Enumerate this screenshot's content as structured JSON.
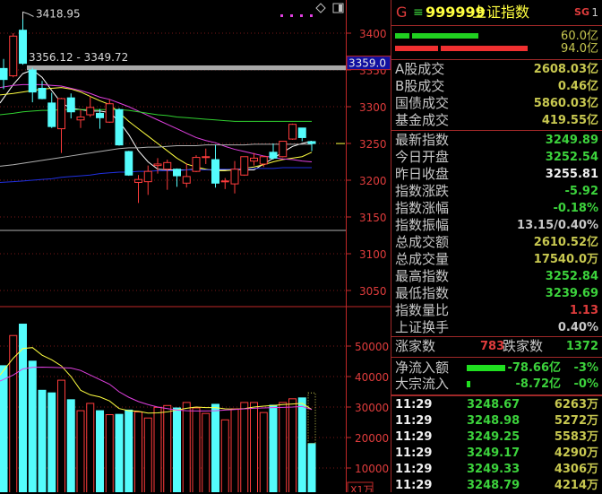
{
  "chart_data": {
    "type": "candlestick",
    "price_axis": {
      "ticks": [
        3400,
        3350,
        3300,
        3250,
        3200,
        3150,
        3100,
        3050
      ]
    },
    "volume_axis": {
      "ticks": [
        50000,
        40000,
        30000,
        20000,
        10000
      ],
      "unit_label": "X1万"
    },
    "high_label": "3418.95",
    "band_label": "3356.12 - 3349.72",
    "band": [
      3349.72,
      3356.12
    ],
    "cursor_price_label": "3359.0",
    "cursor_price": 3359.0,
    "current_price": 3249.89,
    "candles": [
      [
        3352,
        3365,
        3324,
        3337
      ],
      [
        3342,
        3400,
        3340,
        3396
      ],
      [
        3404,
        3418.95,
        3357,
        3359
      ],
      [
        3350,
        3353,
        3306,
        3320
      ],
      [
        3325,
        3335,
        3310,
        3311
      ],
      [
        3305,
        3319,
        3271,
        3273
      ],
      [
        3270,
        3312,
        3237,
        3311
      ],
      [
        3312,
        3318,
        3284,
        3293
      ],
      [
        3282,
        3296,
        3271,
        3286
      ],
      [
        3289,
        3314,
        3286,
        3299
      ],
      [
        3291,
        3297,
        3270,
        3285
      ],
      [
        3279,
        3310,
        3278,
        3304
      ],
      [
        3296,
        3298,
        3247,
        3248
      ],
      [
        3239,
        3240,
        3206,
        3207
      ],
      [
        3197,
        3207,
        3169,
        3201
      ],
      [
        3198,
        3220,
        3180,
        3212
      ],
      [
        3220,
        3230,
        3209,
        3222
      ],
      [
        3215,
        3228,
        3187,
        3224
      ],
      [
        3215,
        3216,
        3191,
        3206
      ],
      [
        3196,
        3223,
        3190,
        3205
      ],
      [
        3212,
        3234,
        3211,
        3231
      ],
      [
        3231,
        3243,
        3222,
        3232
      ],
      [
        3228,
        3248,
        3190,
        3196
      ],
      [
        3198,
        3203,
        3188,
        3199
      ],
      [
        3195,
        3226,
        3182,
        3215
      ],
      [
        3207,
        3232,
        3206,
        3232
      ],
      [
        3226,
        3237,
        3220,
        3230
      ],
      [
        3222,
        3233,
        3218,
        3232
      ],
      [
        3238,
        3250,
        3228,
        3230
      ],
      [
        3232,
        3253,
        3231,
        3253
      ],
      [
        3256,
        3277,
        3255,
        3276
      ],
      [
        3271,
        3271,
        3253,
        3258
      ],
      [
        3252.54,
        3252.84,
        3239.69,
        3249.89
      ]
    ],
    "ma_lines": [
      {
        "name": "MA5",
        "color": "#ffffff",
        "values": [
          3305,
          3330,
          3345,
          3350,
          3340,
          3322,
          3305,
          3298,
          3296,
          3294,
          3294,
          3292,
          3280,
          3262,
          3240,
          3225,
          3215,
          3214,
          3214,
          3214,
          3215,
          3214,
          3214,
          3214,
          3215,
          3214,
          3214,
          3222,
          3230,
          3238,
          3246,
          3250,
          3253
        ]
      },
      {
        "name": "MA10",
        "color": "#ffff40",
        "values": [
          3316,
          3318,
          3320,
          3322,
          3324,
          3325,
          3326,
          3324,
          3320,
          3314,
          3308,
          3303,
          3292,
          3280,
          3270,
          3260,
          3250,
          3240,
          3230,
          3222,
          3218,
          3215,
          3213,
          3213,
          3214,
          3216,
          3218,
          3221,
          3225,
          3228,
          3230,
          3232,
          3238
        ]
      },
      {
        "name": "MA20",
        "color": "#e040e0",
        "values": [
          3326,
          3329,
          3330,
          3330,
          3330,
          3329,
          3328,
          3325,
          3322,
          3318,
          3313,
          3310,
          3305,
          3300,
          3294,
          3288,
          3282,
          3276,
          3270,
          3264,
          3258,
          3254,
          3251,
          3246,
          3242,
          3239,
          3236,
          3233,
          3231,
          3229,
          3228,
          3226,
          3225
        ]
      },
      {
        "name": "MA60",
        "color": "#30d030",
        "values": [
          3289,
          3291,
          3293,
          3294,
          3295,
          3295,
          3296,
          3296,
          3296,
          3296,
          3296,
          3296,
          3296,
          3295,
          3293,
          3291,
          3289,
          3288,
          3286,
          3285,
          3284,
          3283,
          3282,
          3281,
          3280,
          3280,
          3280,
          3280,
          3280,
          3280,
          3280,
          3280,
          3280
        ]
      },
      {
        "name": "MA120",
        "color": "#b0b0b0",
        "values": [
          3219,
          3221,
          3223,
          3225,
          3227,
          3229,
          3231,
          3233,
          3235,
          3237,
          3239,
          3241,
          3243,
          3244,
          3244,
          3245,
          3245,
          3246,
          3247,
          3247,
          3247,
          3248,
          3248,
          3248,
          3248,
          3248,
          3249,
          3249,
          3249,
          3249,
          3249,
          3249,
          3249
        ]
      },
      {
        "name": "MA250",
        "color": "#2030e0",
        "values": [
          3197,
          3198,
          3199,
          3200,
          3201,
          3202,
          3204,
          3205,
          3206,
          3207,
          3209,
          3210,
          3211,
          3211,
          3212,
          3212,
          3213,
          3213,
          3213,
          3214,
          3214,
          3214,
          3215,
          3215,
          3215,
          3216,
          3216,
          3216,
          3216,
          3217,
          3217,
          3217,
          3217
        ]
      }
    ],
    "volumes": [
      43560,
      53460,
      57200,
      45050,
      35500,
      34650,
      38800,
      32400,
      28800,
      31200,
      28800,
      27500,
      27600,
      29000,
      28400,
      26400,
      29900,
      30500,
      29700,
      31500,
      29700,
      27900,
      30900,
      25800,
      29400,
      31500,
      31500,
      28200,
      30600,
      31500,
      32700,
      33000,
      18000
    ],
    "projected_volume": 34650,
    "volume_ma": [
      {
        "name": "VMA5",
        "color": "#ffff40",
        "values": [
          40500,
          46000,
          49200,
          49500,
          47000,
          45500,
          43500,
          40000,
          35500,
          34000,
          33300,
          32000,
          29500,
          28800,
          28600,
          28000,
          28100,
          28400,
          29000,
          29600,
          30000,
          29800,
          29800,
          29400,
          29300,
          29500,
          30000,
          30300,
          30500,
          30800,
          31000,
          31200,
          29200
        ]
      },
      {
        "name": "VMA10",
        "color": "#e040e0",
        "values": [
          38500,
          40500,
          42500,
          43000,
          43100,
          43000,
          42900,
          42800,
          42000,
          40500,
          39000,
          37500,
          35000,
          33200,
          31800,
          30800,
          30000,
          29500,
          29000,
          28800,
          28700,
          28700,
          28800,
          29000,
          29200,
          29400,
          29600,
          29700,
          29800,
          29900,
          30000,
          30200,
          29200
        ]
      }
    ],
    "colors": {
      "up": "#ff3c3c",
      "down": "#54fcfc",
      "axis": "#c02828"
    }
  },
  "panel": {
    "market_icon": "G",
    "menu_icon": "≡",
    "code": "999999",
    "name": "上证指数",
    "sg_label": "SG",
    "sg_num": "1",
    "flow_in": "60.0亿",
    "flow_out": "94.0亿",
    "turnover": [
      {
        "label": "A股成交",
        "value": "2608.03亿"
      },
      {
        "label": "B股成交",
        "value": "0.46亿"
      },
      {
        "label": "国债成交",
        "value": "5860.03亿"
      },
      {
        "label": "基金成交",
        "value": "419.55亿"
      }
    ],
    "stats": [
      {
        "label": "最新指数",
        "value": "3249.89",
        "c": "g"
      },
      {
        "label": "今日开盘",
        "value": "3252.54",
        "c": "g"
      },
      {
        "label": "昨日收盘",
        "value": "3255.81",
        "c": "w"
      },
      {
        "label": "指数涨跌",
        "value": "-5.92",
        "c": "g"
      },
      {
        "label": "指数涨幅",
        "value": "-0.18%",
        "c": "g"
      },
      {
        "label": "指数振幅",
        "value": "13.15/0.40%",
        "c": "gr"
      },
      {
        "label": "总成交额",
        "value": "2610.52亿",
        "c": "y"
      },
      {
        "label": "总成交量",
        "value": "17540.0万",
        "c": "y"
      },
      {
        "label": "最高指数",
        "value": "3252.84",
        "c": "g"
      },
      {
        "label": "最低指数",
        "value": "3239.69",
        "c": "g"
      },
      {
        "label": "指数量比",
        "value": "1.13",
        "c": "r"
      },
      {
        "label": "上证换手",
        "value": "0.40%",
        "c": "gr"
      }
    ],
    "adv_label": "涨家数",
    "adv": "783",
    "dec_label": "跌家数",
    "dec": "1372",
    "netflow": [
      {
        "label": "净流入额",
        "value": "-78.66亿",
        "pct": "-3%",
        "bar": 1.0
      },
      {
        "label": "大宗流入",
        "value": "-8.72亿",
        "pct": "-0%",
        "bar": 0.1
      }
    ],
    "ticks": [
      {
        "time": "11:29",
        "price": "3248.67",
        "vol": "6263万"
      },
      {
        "time": "11:29",
        "price": "3248.98",
        "vol": "5272万"
      },
      {
        "time": "11:29",
        "price": "3249.25",
        "vol": "5583万"
      },
      {
        "time": "11:29",
        "price": "3249.17",
        "vol": "4290万"
      },
      {
        "time": "11:29",
        "price": "3249.33",
        "vol": "4306万"
      },
      {
        "time": "11:29",
        "price": "3248.79",
        "vol": "4214万"
      }
    ]
  }
}
